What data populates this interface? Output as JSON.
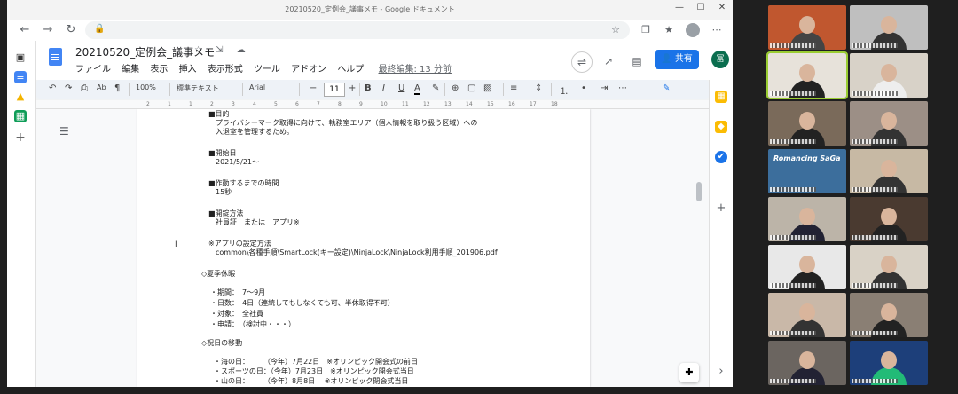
{
  "browser": {
    "title": "20210520_定例会_議事メモ - Google ドキュメント",
    "controls": {
      "min": "—",
      "max": "☐",
      "close": "✕"
    },
    "nav": {
      "back": "←",
      "forward": "→",
      "reload": "↻",
      "lock": "🔒"
    },
    "toolbar_icons": {
      "star": "☆",
      "collections": "❐",
      "favorites": "★",
      "extensions": "⬚"
    }
  },
  "rail": {
    "icons": {
      "tabs": "▣",
      "docs": "≡",
      "drive": "▲",
      "sheets": "▦",
      "add": "+"
    }
  },
  "doc": {
    "title": "20210520_定例会_議事メモ",
    "title_icons": "☆ ⇲ ☁",
    "menu": [
      "ファイル",
      "編集",
      "表示",
      "挿入",
      "表示形式",
      "ツール",
      "アドオン",
      "ヘルプ"
    ],
    "last_edit": "最終編集: 13 分前",
    "share_label": "共有",
    "user_initial": "冨",
    "header_icons": {
      "present": "⇌",
      "trend": "↗",
      "comment": "▤"
    }
  },
  "toolbar": {
    "undo": "↶",
    "redo": "↷",
    "print": "⎙",
    "spell": "Ab",
    "paint": "¶",
    "zoom": "100%",
    "style": "標準テキスト",
    "font": "Arial",
    "minus": "−",
    "size": "11",
    "plus": "+",
    "bold": "B",
    "italic": "I",
    "underline": "U",
    "color": "A",
    "highlight": "✎",
    "link": "⊕",
    "comment": "▢",
    "image": "▨",
    "align": "≡",
    "spacing": "⇕",
    "numlist": "⒈",
    "bulllist": "•",
    "indent": "⇥",
    "more": "⋯",
    "edit": "✎"
  },
  "ruler": [
    "2",
    "1",
    "1",
    "2",
    "3",
    "4",
    "5",
    "6",
    "7",
    "8",
    "9",
    "10",
    "11",
    "12",
    "13",
    "14",
    "15",
    "16",
    "17",
    "18"
  ],
  "content": [
    "■目的",
    "プライバシーマーク取得に向けて、執務室エリア（個人情報を取り扱う区域）への",
    "入退室を管理するため。",
    "■開始日",
    "2021/5/21～",
    "■作動するまでの時間",
    "15秒",
    "■開錠方法",
    "社員証　または　アプリ※",
    "※アプリの設定方法",
    "common\\各種手順\\SmartLock(キー設定)\\NinjaLock\\NinjaLock利用手順_201906.pdf",
    "◇夏季休暇",
    "・期間：　7～9月",
    "・日数：　4日（連続してもしなくても可、半休取得不可）",
    "・対象：　全社員",
    "・申請：　（検討中・・・）",
    "◇祝日の移動",
    "・海の日：　　　（今年）7月22日　※オリンピック開会式の前日",
    "・スポーツの日：（今年）7月23日　※オリンピック開会式当日",
    "・山の日：　　　（今年）8月8日　 ※オリンピック閉会式当日"
  ],
  "side": {
    "icons": {
      "calendar": "▦",
      "keep": "◆",
      "tasks": "✔",
      "add": "+",
      "expand": "›"
    }
  },
  "explore": "✚",
  "participants": [
    {
      "bg": "#c0572f",
      "body": "#444",
      "avatar": "",
      "active": false
    },
    {
      "bg": "#bfbfbf",
      "body": "#333",
      "avatar": "",
      "active": false
    },
    {
      "bg": "#e7e2da",
      "body": "#222",
      "avatar": "",
      "active": true
    },
    {
      "bg": "#d8d2c8",
      "body": "#eee",
      "avatar": "",
      "active": false
    },
    {
      "bg": "#7a6a5a",
      "body": "#222",
      "avatar": "",
      "active": false
    },
    {
      "bg": "#9c8f86",
      "body": "#333",
      "avatar": "",
      "active": false
    },
    {
      "bg": "#3c6e9c",
      "body": "#2a6",
      "avatar": "Romancing SaGa",
      "active": false
    },
    {
      "bg": "#c7b9a4",
      "body": "#333",
      "avatar": "",
      "active": false
    },
    {
      "bg": "#bcb4a8",
      "body": "#223",
      "avatar": "",
      "active": false
    },
    {
      "bg": "#4a3a30",
      "body": "#222",
      "avatar": "",
      "active": false
    },
    {
      "bg": "#e8e8e8",
      "body": "#222",
      "avatar": "",
      "active": false
    },
    {
      "bg": "#d9d2c6",
      "body": "#333",
      "avatar": "",
      "active": false
    },
    {
      "bg": "#c9b8a8",
      "body": "#333",
      "avatar": "",
      "active": false
    },
    {
      "bg": "#8a7f74",
      "body": "#222",
      "avatar": "",
      "active": false
    },
    {
      "bg": "#6b6560",
      "body": "#223",
      "avatar": "",
      "active": false
    },
    {
      "bg": "#1d3f7a",
      "body": "#2b7",
      "avatar": "",
      "active": false
    }
  ]
}
